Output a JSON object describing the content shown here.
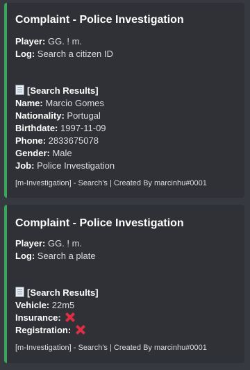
{
  "embeds": [
    {
      "title": "Complaint - Police Investigation",
      "player_label": "Player:",
      "player_value": " GG. ! m.",
      "log_label": "Log:",
      "log_value": " Search a citizen ID",
      "results_label": "[Search Results]",
      "fields": [
        {
          "label": "Name:",
          "value": " Marcio Gomes"
        },
        {
          "label": "Nationality:",
          "value": " Portugal"
        },
        {
          "label": "Birthdate:",
          "value": " 1997-11-09"
        },
        {
          "label": "Phone:",
          "value": " 2833675078"
        },
        {
          "label": "Gender:",
          "value": " Male"
        },
        {
          "label": "Job:",
          "value": " Police Investigation"
        }
      ],
      "footer": "[m-Investigation] - Search's | Created By marcinhu#0001"
    },
    {
      "title": "Complaint - Police Investigation",
      "player_label": "Player:",
      "player_value": " GG. ! m.",
      "log_label": "Log:",
      "log_value": " Search a plate",
      "results_label": "[Search Results]",
      "fields": [
        {
          "label": "Vehicle:",
          "value": " 22m5"
        },
        {
          "label": "Insurance:",
          "value": " ",
          "icon": "cross-mark-icon"
        },
        {
          "label": "Registration:",
          "value": " ",
          "icon": "cross-mark-icon"
        }
      ],
      "footer": "[m-Investigation] - Search's | Created By marcinhu#0001"
    }
  ],
  "colors": {
    "background": "#36393f",
    "embed_background": "#2f3136",
    "accent_border": "#3ba55d",
    "cross_mark": "#dd2e44"
  }
}
